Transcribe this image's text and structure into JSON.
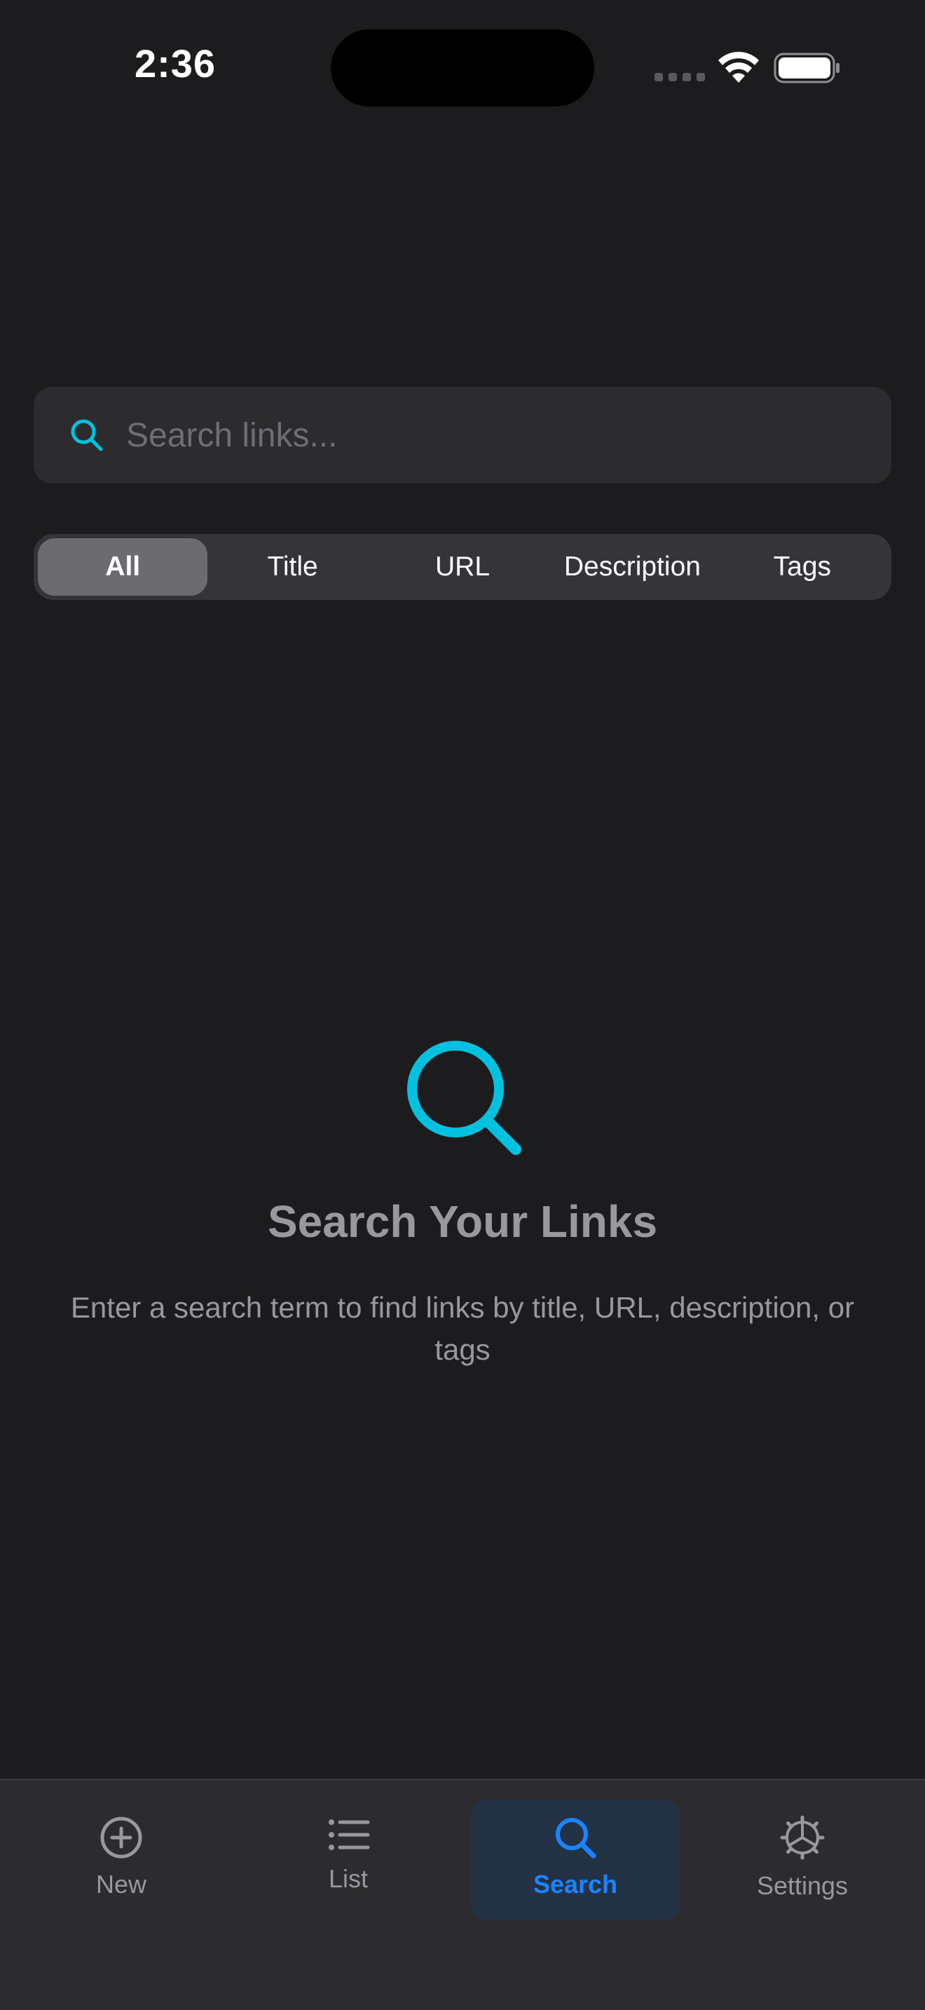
{
  "status_bar": {
    "time": "2:36",
    "wifi_icon": "wifi-icon",
    "battery_icon": "battery-icon"
  },
  "search": {
    "placeholder": "Search links...",
    "value": "",
    "icon": "search-icon",
    "icon_color": "#00c2e0"
  },
  "filters": {
    "items": [
      {
        "label": "All",
        "selected": true
      },
      {
        "label": "Title",
        "selected": false
      },
      {
        "label": "URL",
        "selected": false
      },
      {
        "label": "Description",
        "selected": false
      },
      {
        "label": "Tags",
        "selected": false
      }
    ]
  },
  "empty_state": {
    "icon": "magnifier-icon",
    "title": "Search Your Links",
    "subtitle": "Enter a search term to find links by title, URL, description, or tags"
  },
  "tab_bar": {
    "tabs": [
      {
        "label": "New",
        "icon": "plus-circle-icon",
        "active": false
      },
      {
        "label": "List",
        "icon": "list-icon",
        "active": false
      },
      {
        "label": "Search",
        "icon": "search-icon",
        "active": true
      },
      {
        "label": "Settings",
        "icon": "gear-icon",
        "active": false
      }
    ],
    "active_color": "#1a84ff",
    "inactive_color": "#98989d"
  },
  "colors": {
    "background": "#1c1c1e",
    "surface": "#2c2c2e",
    "accent_cyan": "#00c2e0",
    "accent_blue": "#1a84ff"
  }
}
